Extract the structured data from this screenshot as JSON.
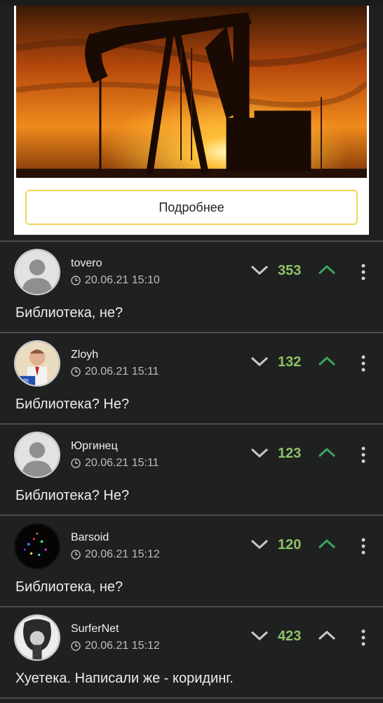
{
  "ad": {
    "button_label": "Подробнее"
  },
  "colors": {
    "background": "#1f2020",
    "score_green": "#8dc26a",
    "upvote_green": "#3aa55b",
    "button_border": "#f2d35b"
  },
  "comments": [
    {
      "username": "tovero",
      "timestamp": "20.06.21 15:10",
      "score": "353",
      "text": "Библиотека, не?",
      "upvoted": true,
      "avatar": "default-avatar"
    },
    {
      "username": "Zloyh",
      "timestamp": "20.06.21 15:11",
      "score": "132",
      "text": "Библиотека? Не?",
      "upvoted": true,
      "avatar": "poster-avatar"
    },
    {
      "username": "Юргинец",
      "timestamp": "20.06.21 15:11",
      "score": "123",
      "text": "Библиотека? Не?",
      "upvoted": true,
      "avatar": "default-avatar"
    },
    {
      "username": "Barsoid",
      "timestamp": "20.06.21 15:12",
      "score": "120",
      "text": "Библиотека, не?",
      "upvoted": true,
      "avatar": "dots-avatar"
    },
    {
      "username": "SurferNet",
      "timestamp": "20.06.21 15:12",
      "score": "423",
      "text": "Хуетека. Написали же - коридинг.",
      "upvoted": false,
      "avatar": "bw-photo-avatar"
    }
  ]
}
